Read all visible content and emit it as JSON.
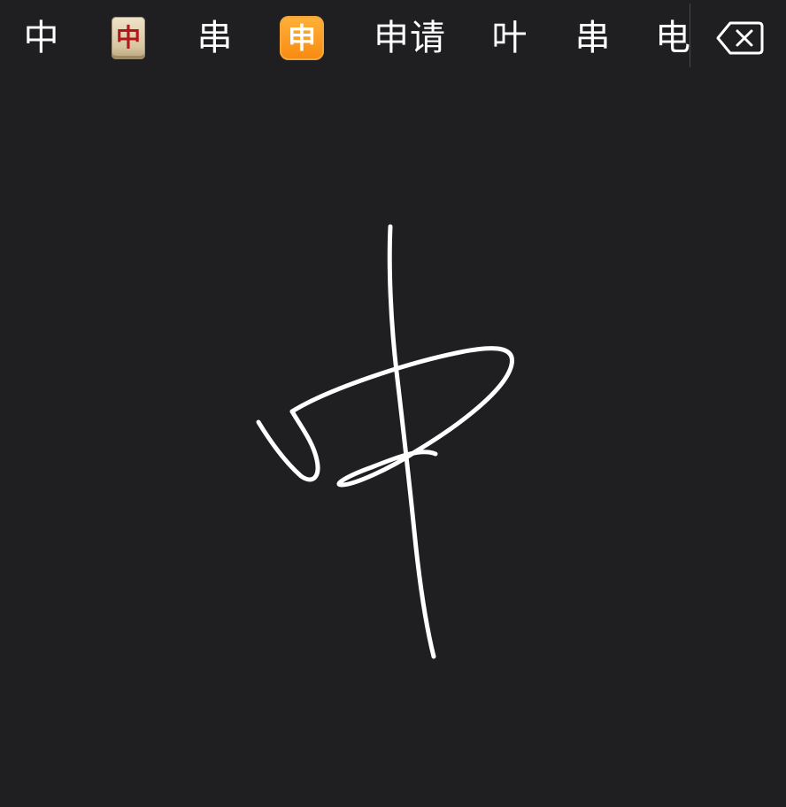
{
  "candidates": [
    {
      "kind": "text",
      "label": "中"
    },
    {
      "kind": "mahjong-emoji",
      "label": "中",
      "icon": "mahjong-red-dragon-icon"
    },
    {
      "kind": "text",
      "label": "串"
    },
    {
      "kind": "square-emoji",
      "label": "申",
      "icon": "japanese-monthly-amount-button-icon",
      "color": "#f88a10"
    },
    {
      "kind": "text",
      "label": "申请"
    },
    {
      "kind": "text",
      "label": "叶"
    },
    {
      "kind": "text",
      "label": "串"
    },
    {
      "kind": "text",
      "label": "电"
    }
  ],
  "delete_key": {
    "icon": "delete-backspace-icon"
  },
  "handwriting": {
    "stroke_color": "#ffffff",
    "background": "#1f1e21"
  }
}
